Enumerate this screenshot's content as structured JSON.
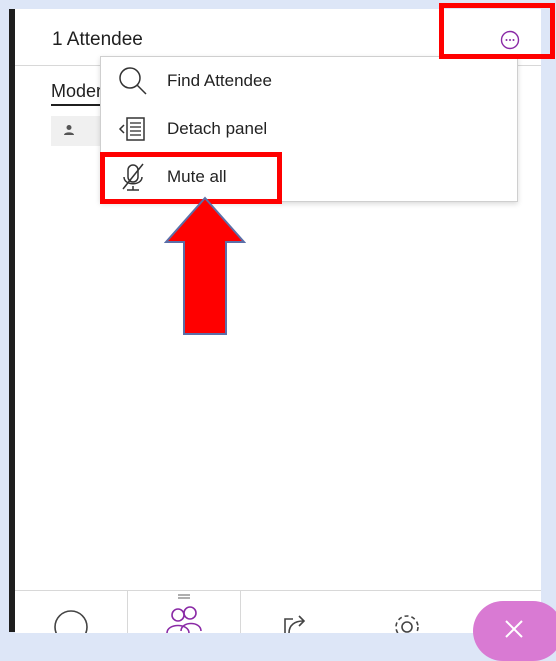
{
  "header": {
    "title": "1 Attendee",
    "more_icon": "ellipsis-circle-icon",
    "accent": "#8a2aa6"
  },
  "list": {
    "section_label": "Moderators",
    "avatar_icon": "person-icon"
  },
  "menu": {
    "items": [
      {
        "label": "Find Attendee",
        "icon": "search-icon"
      },
      {
        "label": "Detach panel",
        "icon": "detach-panel-icon"
      },
      {
        "label": "Mute all",
        "icon": "microphone-muted-icon"
      }
    ]
  },
  "annotation": {
    "color": "#ff0000"
  },
  "toolbar": {
    "buttons": [
      {
        "icon": "chat-icon"
      },
      {
        "icon": "attendees-icon",
        "active": true
      },
      {
        "icon": "share-content-icon"
      },
      {
        "icon": "gear-icon"
      },
      {
        "icon": "close-icon"
      }
    ]
  }
}
